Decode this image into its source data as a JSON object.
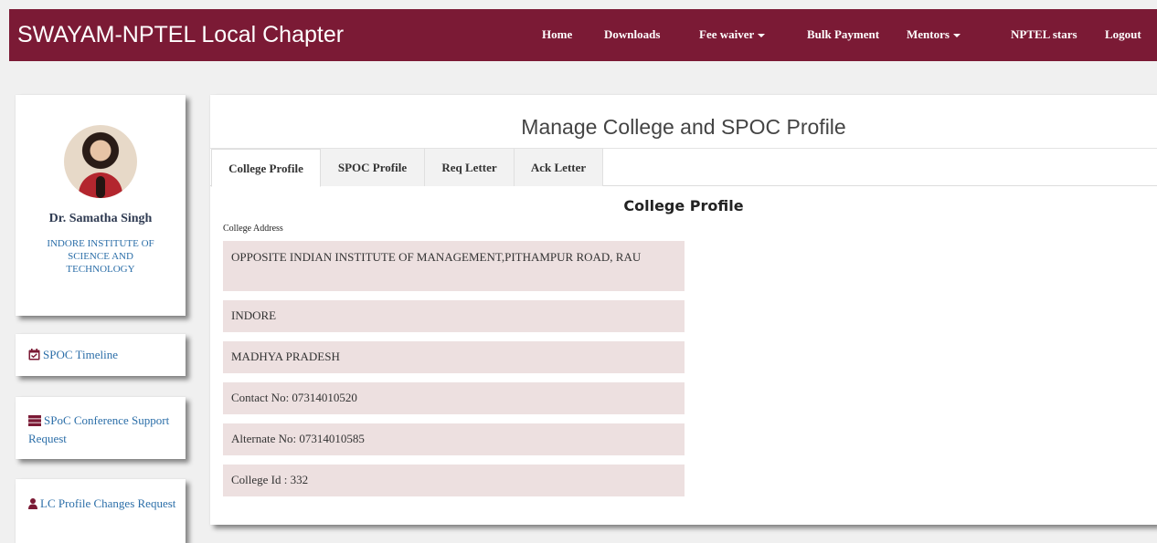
{
  "app": {
    "brand": "SWAYAM-NPTEL Local Chapter"
  },
  "nav": {
    "items": [
      {
        "label": "Home",
        "dropdown": false
      },
      {
        "label": "Downloads",
        "dropdown": false
      },
      {
        "label": "Fee waiver",
        "dropdown": true
      },
      {
        "label": "Bulk Payment",
        "dropdown": false
      },
      {
        "label": "Mentors",
        "dropdown": true
      },
      {
        "label": "NPTEL stars",
        "dropdown": false
      },
      {
        "label": "Logout",
        "dropdown": false
      }
    ]
  },
  "profile": {
    "name": "Dr. Samatha Singh",
    "institute": "INDORE INSTITUTE OF SCIENCE AND TECHNOLOGY"
  },
  "sidebar": {
    "links": [
      {
        "label": "SPOC Timeline",
        "icon": "calendar-check-icon"
      },
      {
        "label": "SPoC Conference Support Request",
        "icon": "server-icon"
      },
      {
        "label": "LC Profile Changes Request",
        "icon": "user-icon"
      }
    ]
  },
  "main": {
    "title": "Manage College and SPOC Profile",
    "tabs": [
      {
        "label": "College Profile",
        "active": true
      },
      {
        "label": "SPOC Profile",
        "active": false
      },
      {
        "label": "Req Letter",
        "active": false
      },
      {
        "label": "Ack Letter",
        "active": false
      }
    ],
    "section_title": "College Profile",
    "address_label": "College Address",
    "fields": {
      "address": "OPPOSITE INDIAN INSTITUTE OF MANAGEMENT,PITHAMPUR ROAD, RAU",
      "city": "INDORE",
      "state": "MADHYA PRADESH",
      "contact": "Contact No: 07314010520",
      "alternate": "Alternate No: 07314010585",
      "college_id": "College Id : 332"
    }
  },
  "colors": {
    "navbar": "#7b1a35",
    "link": "#2b6ea8",
    "field_bg": "#ede0e0",
    "icon": "#7b1a35"
  }
}
